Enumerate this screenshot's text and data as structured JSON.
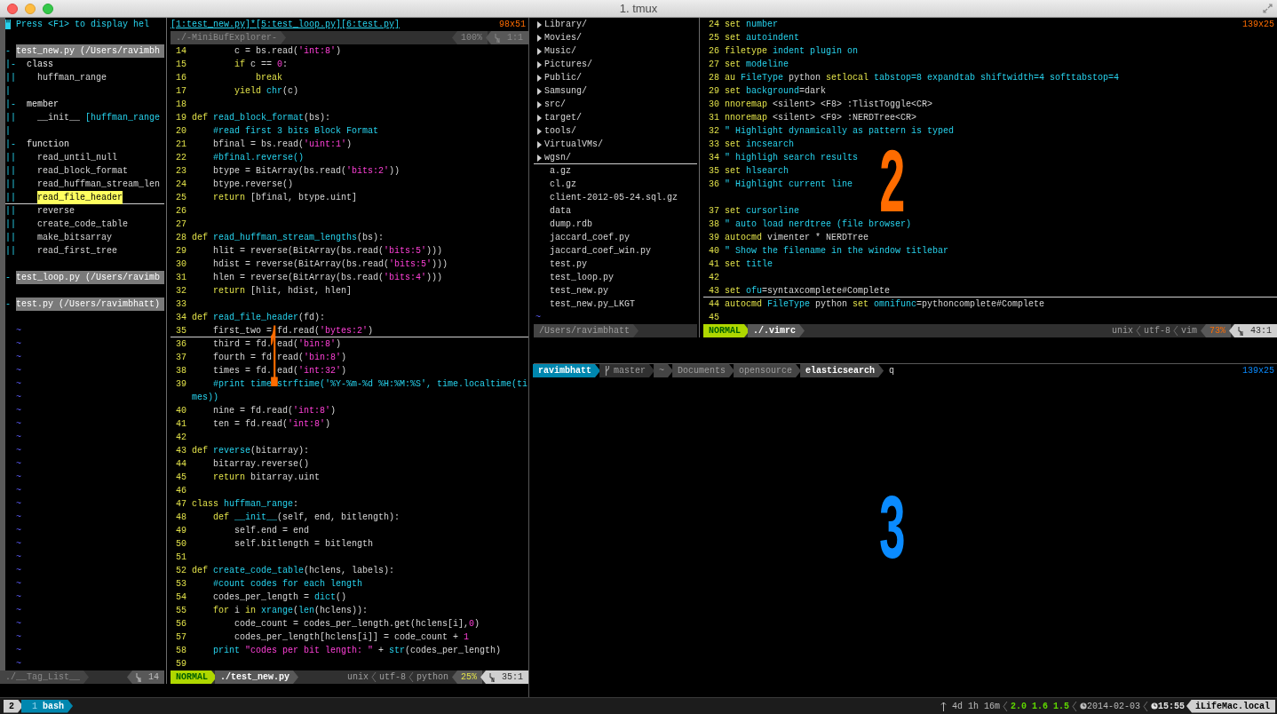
{
  "window": {
    "title": "1. tmux"
  },
  "pane_1": {
    "active": false,
    "size": "98x51",
    "pane_number": "1",
    "taglist": {
      "rows": [
        {
          "kind": "help",
          "fold": "\"",
          "label": "Press <F1> to display hel"
        },
        {
          "kind": "blank"
        },
        {
          "kind": "file",
          "fold": "-",
          "label": "test_new.py (/Users/ravimbh"
        },
        {
          "kind": "group",
          "fold": "|-",
          "label": "class"
        },
        {
          "kind": "tag",
          "fold": "||",
          "label": "huffman_range",
          "selected": false
        },
        {
          "kind": "blank",
          "fold": "|"
        },
        {
          "kind": "group",
          "fold": "|-",
          "label": "member"
        },
        {
          "kind": "tag",
          "fold": "||",
          "label": "__init__",
          "scope": "[huffman_range",
          "selected": false
        },
        {
          "kind": "blank",
          "fold": "|"
        },
        {
          "kind": "group",
          "fold": "|-",
          "label": "function"
        },
        {
          "kind": "tag",
          "fold": "||",
          "label": "read_until_null",
          "selected": false
        },
        {
          "kind": "tag",
          "fold": "||",
          "label": "read_block_format",
          "selected": false
        },
        {
          "kind": "tag",
          "fold": "||",
          "label": "read_huffman_stream_len",
          "selected": false
        },
        {
          "kind": "tag",
          "fold": "||",
          "label": "read_file_header",
          "selected": true
        },
        {
          "kind": "tag",
          "fold": "||",
          "label": "reverse",
          "selected": false
        },
        {
          "kind": "tag",
          "fold": "||",
          "label": "create_code_table",
          "selected": false
        },
        {
          "kind": "tag",
          "fold": "||",
          "label": "make_bitsarray",
          "selected": false
        },
        {
          "kind": "tag",
          "fold": "||",
          "label": "read_first_tree",
          "selected": false
        },
        {
          "kind": "blank"
        },
        {
          "kind": "file",
          "fold": "-",
          "label": "test_loop.py (/Users/ravimb"
        },
        {
          "kind": "blank"
        },
        {
          "kind": "file",
          "fold": "-",
          "label": "test.py (/Users/ravimbhatt)"
        },
        {
          "kind": "blank"
        },
        {
          "kind": "tilde",
          "label": "~"
        },
        {
          "kind": "tilde",
          "label": "~"
        },
        {
          "kind": "tilde",
          "label": "~"
        },
        {
          "kind": "tilde",
          "label": "~"
        },
        {
          "kind": "tilde",
          "label": "~"
        },
        {
          "kind": "tilde",
          "label": "~"
        },
        {
          "kind": "tilde",
          "label": "~"
        },
        {
          "kind": "tilde",
          "label": "~"
        },
        {
          "kind": "tilde",
          "label": "~"
        },
        {
          "kind": "tilde",
          "label": "~"
        },
        {
          "kind": "tilde",
          "label": "~"
        },
        {
          "kind": "tilde",
          "label": "~"
        },
        {
          "kind": "tilde",
          "label": "~"
        },
        {
          "kind": "tilde",
          "label": "~"
        },
        {
          "kind": "tilde",
          "label": "~"
        },
        {
          "kind": "tilde",
          "label": "~"
        },
        {
          "kind": "tilde",
          "label": "~"
        },
        {
          "kind": "tilde",
          "label": "~"
        },
        {
          "kind": "tilde",
          "label": "~"
        },
        {
          "kind": "tilde",
          "label": "~"
        },
        {
          "kind": "tilde",
          "label": "~"
        },
        {
          "kind": "tilde",
          "label": "~"
        },
        {
          "kind": "tilde",
          "label": "~"
        },
        {
          "kind": "tilde",
          "label": "~"
        },
        {
          "kind": "tilde",
          "label": "~"
        },
        {
          "kind": "tilde",
          "label": "~"
        }
      ],
      "status": {
        "name": "./__Tag_List__",
        "line": "14"
      }
    },
    "code": {
      "buffers": "[1:test_new.py]*[5:test_loop.py][6:test.py]",
      "explorer_status": {
        "name": "./-MiniBufExplorer-",
        "percent": "100%",
        "position": "1:1"
      },
      "lines": [
        {
          "n": "14",
          "t": [
            {
              "text": "        c = bs.read(",
              "kind": "plain"
            },
            {
              "text": "'int:8'",
              "kind": "string"
            },
            {
              "text": ")",
              "kind": "plain"
            }
          ]
        },
        {
          "n": "15",
          "t": [
            {
              "text": "        if",
              "kind": "keyword"
            },
            {
              "text": " c == ",
              "kind": "plain"
            },
            {
              "text": "0",
              "kind": "string"
            },
            {
              "text": ":",
              "kind": "plain"
            }
          ]
        },
        {
          "n": "16",
          "t": [
            {
              "text": "            break",
              "kind": "keyword"
            }
          ]
        },
        {
          "n": "17",
          "t": [
            {
              "text": "        yield ",
              "kind": "keyword"
            },
            {
              "text": "chr",
              "kind": "name"
            },
            {
              "text": "(c)",
              "kind": "plain"
            }
          ]
        },
        {
          "n": "18"
        },
        {
          "n": "19",
          "t": [
            {
              "text": "def ",
              "kind": "keyword"
            },
            {
              "text": "read_block_format",
              "kind": "name"
            },
            {
              "text": "(bs):",
              "kind": "plain"
            }
          ]
        },
        {
          "n": "20",
          "t": [
            {
              "text": "    #read first 3 bits Block Format",
              "kind": "comment"
            }
          ]
        },
        {
          "n": "21",
          "t": [
            {
              "text": "    bfinal = bs.read(",
              "kind": "plain"
            },
            {
              "text": "'uint:1'",
              "kind": "string"
            },
            {
              "text": ")",
              "kind": "plain"
            }
          ]
        },
        {
          "n": "22",
          "t": [
            {
              "text": "    #bfinal.reverse()",
              "kind": "comment"
            }
          ]
        },
        {
          "n": "23",
          "t": [
            {
              "text": "    btype = BitArray(bs.read(",
              "kind": "plain"
            },
            {
              "text": "'bits:2'",
              "kind": "string"
            },
            {
              "text": "))",
              "kind": "plain"
            }
          ]
        },
        {
          "n": "24",
          "t": [
            {
              "text": "    btype.reverse()",
              "kind": "plain"
            }
          ]
        },
        {
          "n": "25",
          "t": [
            {
              "text": "    return",
              "kind": "keyword"
            },
            {
              "text": " [bfinal, btype.uint]",
              "kind": "plain"
            }
          ]
        },
        {
          "n": "26"
        },
        {
          "n": "27"
        },
        {
          "n": "28",
          "t": [
            {
              "text": "def ",
              "kind": "keyword"
            },
            {
              "text": "read_huffman_stream_lengths",
              "kind": "name"
            },
            {
              "text": "(bs):",
              "kind": "plain"
            }
          ]
        },
        {
          "n": "29",
          "t": [
            {
              "text": "    hlit = reverse(BitArray(bs.read(",
              "kind": "plain"
            },
            {
              "text": "'bits:5'",
              "kind": "string"
            },
            {
              "text": ")))",
              "kind": "plain"
            }
          ]
        },
        {
          "n": "30",
          "t": [
            {
              "text": "    hdist = reverse(BitArray(bs.read(",
              "kind": "plain"
            },
            {
              "text": "'bits:5'",
              "kind": "string"
            },
            {
              "text": ")))",
              "kind": "plain"
            }
          ]
        },
        {
          "n": "31",
          "t": [
            {
              "text": "    hlen = reverse(BitArray(bs.read(",
              "kind": "plain"
            },
            {
              "text": "'bits:4'",
              "kind": "string"
            },
            {
              "text": ")))",
              "kind": "plain"
            }
          ]
        },
        {
          "n": "32",
          "t": [
            {
              "text": "    return",
              "kind": "keyword"
            },
            {
              "text": " [hlit, hdist, hlen]",
              "kind": "plain"
            }
          ]
        },
        {
          "n": "33"
        },
        {
          "n": "34",
          "t": [
            {
              "text": "def ",
              "kind": "keyword"
            },
            {
              "text": "read_file_header",
              "kind": "name"
            },
            {
              "text": "(fd):",
              "kind": "plain"
            }
          ]
        },
        {
          "n": "35",
          "cursorline": true,
          "t": [
            {
              "text": "    first_two = fd.read(",
              "kind": "plain"
            },
            {
              "text": "'bytes:2'",
              "kind": "string"
            },
            {
              "text": ")",
              "kind": "plain"
            }
          ]
        },
        {
          "n": "36",
          "t": [
            {
              "text": "    third = fd. ead(",
              "kind": "plain"
            },
            {
              "text": "'bin:8'",
              "kind": "string"
            },
            {
              "text": ")",
              "kind": "plain"
            }
          ]
        },
        {
          "n": "37",
          "t": [
            {
              "text": "    fourth = fd read(",
              "kind": "plain"
            },
            {
              "text": "'bin:8'",
              "kind": "string"
            },
            {
              "text": ")",
              "kind": "plain"
            }
          ]
        },
        {
          "n": "38",
          "t": [
            {
              "text": "    times = fd. ead(",
              "kind": "plain"
            },
            {
              "text": "'int:32'",
              "kind": "string"
            },
            {
              "text": ")",
              "kind": "plain"
            }
          ]
        },
        {
          "n": "39",
          "t": [
            {
              "text": "    #print time strftime('%Y-%m-%d %H:%M:%S', time.localtime(ti",
              "kind": "comment"
            }
          ]
        },
        {
          "t": [
            {
              "text": "mes))",
              "kind": "comment"
            }
          ]
        },
        {
          "n": "40",
          "t": [
            {
              "text": "    nine = fd.read(",
              "kind": "plain"
            },
            {
              "text": "'int:8'",
              "kind": "string"
            },
            {
              "text": ")",
              "kind": "plain"
            }
          ]
        },
        {
          "n": "41",
          "t": [
            {
              "text": "    ten = fd.read(",
              "kind": "plain"
            },
            {
              "text": "'int:8'",
              "kind": "string"
            },
            {
              "text": ")",
              "kind": "plain"
            }
          ]
        },
        {
          "n": "42"
        },
        {
          "n": "43",
          "t": [
            {
              "text": "def ",
              "kind": "keyword"
            },
            {
              "text": "reverse",
              "kind": "name"
            },
            {
              "text": "(bitarray):",
              "kind": "plain"
            }
          ]
        },
        {
          "n": "44",
          "t": [
            {
              "text": "    bitarray.reverse()",
              "kind": "plain"
            }
          ]
        },
        {
          "n": "45",
          "t": [
            {
              "text": "    return",
              "kind": "keyword"
            },
            {
              "text": " bitarray.uint",
              "kind": "plain"
            }
          ]
        },
        {
          "n": "46"
        },
        {
          "n": "47",
          "t": [
            {
              "text": "class ",
              "kind": "keyword"
            },
            {
              "text": "huffman_range",
              "kind": "name"
            },
            {
              "text": ":",
              "kind": "plain"
            }
          ]
        },
        {
          "n": "48",
          "t": [
            {
              "text": "    def ",
              "kind": "keyword"
            },
            {
              "text": "__init__",
              "kind": "name"
            },
            {
              "text": "(self, end, bitlength):",
              "kind": "plain"
            }
          ]
        },
        {
          "n": "49",
          "t": [
            {
              "text": "        self.end = end",
              "kind": "plain"
            }
          ]
        },
        {
          "n": "50",
          "t": [
            {
              "text": "        self.bitlength = bitlength",
              "kind": "plain"
            }
          ]
        },
        {
          "n": "51"
        },
        {
          "n": "52",
          "t": [
            {
              "text": "def ",
              "kind": "keyword"
            },
            {
              "text": "create_code_table",
              "kind": "name"
            },
            {
              "text": "(hclens, labels):",
              "kind": "plain"
            }
          ]
        },
        {
          "n": "53",
          "t": [
            {
              "text": "    #count codes for each length",
              "kind": "comment"
            }
          ]
        },
        {
          "n": "54",
          "t": [
            {
              "text": "    codes_per_length = ",
              "kind": "plain"
            },
            {
              "text": "dict",
              "kind": "name"
            },
            {
              "text": "()",
              "kind": "plain"
            }
          ]
        },
        {
          "n": "55",
          "t": [
            {
              "text": "    for",
              "kind": "keyword"
            },
            {
              "text": " i ",
              "kind": "plain"
            },
            {
              "text": "in ",
              "kind": "keyword"
            },
            {
              "text": "xrange",
              "kind": "name"
            },
            {
              "text": "(",
              "kind": "plain"
            },
            {
              "text": "len",
              "kind": "name"
            },
            {
              "text": "(hclens)):",
              "kind": "plain"
            }
          ]
        },
        {
          "n": "56",
          "t": [
            {
              "text": "        code_count = codes_per_length.get(hclens[i],",
              "kind": "plain"
            },
            {
              "text": "0",
              "kind": "string"
            },
            {
              "text": ")",
              "kind": "plain"
            }
          ]
        },
        {
          "n": "57",
          "t": [
            {
              "text": "        codes_per_length[hclens[i]] = code_count + ",
              "kind": "plain"
            },
            {
              "text": "1",
              "kind": "string"
            }
          ]
        },
        {
          "n": "58",
          "t": [
            {
              "text": "    print ",
              "kind": "name"
            },
            {
              "text": "\"codes per bit length: \"",
              "kind": "string"
            },
            {
              "text": " + ",
              "kind": "plain"
            },
            {
              "text": "str",
              "kind": "name"
            },
            {
              "text": "(codes_per_length)",
              "kind": "plain"
            }
          ]
        },
        {
          "n": "59"
        }
      ],
      "status": {
        "mode": "NORMAL",
        "file": "./test_new.py",
        "format": "unix",
        "encoding": "utf-8",
        "filetype": "python",
        "percent": "25%",
        "position": "35:1"
      }
    }
  },
  "pane_2": {
    "active": false,
    "size": "139x25",
    "pane_number": "2",
    "nerdtree": {
      "entries": [
        {
          "kind": "dir",
          "name": "Library/"
        },
        {
          "kind": "dir",
          "name": "Movies/"
        },
        {
          "kind": "dir",
          "name": "Music/"
        },
        {
          "kind": "dir",
          "name": "Pictures/"
        },
        {
          "kind": "dir",
          "name": "Public/"
        },
        {
          "kind": "dir",
          "name": "Samsung/"
        },
        {
          "kind": "dir",
          "name": "src/"
        },
        {
          "kind": "dir",
          "name": "target/"
        },
        {
          "kind": "dir",
          "name": "tools/"
        },
        {
          "kind": "dir",
          "name": "VirtualVMs/"
        },
        {
          "kind": "dir",
          "name": "wgsn/",
          "cursorline": true
        },
        {
          "kind": "file",
          "name": "a.gz"
        },
        {
          "kind": "file",
          "name": "cl.gz"
        },
        {
          "kind": "file",
          "name": "client-2012-05-24.sql.gz"
        },
        {
          "kind": "file",
          "name": "data"
        },
        {
          "kind": "file",
          "name": "dump.rdb"
        },
        {
          "kind": "file",
          "name": "jaccard_coef.py"
        },
        {
          "kind": "file",
          "name": "jaccard_coef_win.py"
        },
        {
          "kind": "file",
          "name": "test.py"
        },
        {
          "kind": "file",
          "name": "test_loop.py"
        },
        {
          "kind": "file",
          "name": "test_new.py"
        },
        {
          "kind": "file",
          "name": "test_new.py_LKGT"
        }
      ],
      "tilde": "~",
      "status": "/Users/ravimbhatt"
    },
    "vimrc": {
      "lines": [
        {
          "n": "24",
          "t": [
            {
              "text": "set",
              "kind": "keyword"
            },
            {
              "text": " number",
              "kind": "name"
            }
          ]
        },
        {
          "n": "25",
          "t": [
            {
              "text": "set",
              "kind": "keyword"
            },
            {
              "text": " autoindent",
              "kind": "name"
            }
          ]
        },
        {
          "n": "26",
          "t": [
            {
              "text": "filetype",
              "kind": "keyword"
            },
            {
              "text": " indent plugin on",
              "kind": "name"
            }
          ]
        },
        {
          "n": "27",
          "t": [
            {
              "text": "set",
              "kind": "keyword"
            },
            {
              "text": " modeline",
              "kind": "name"
            }
          ]
        },
        {
          "n": "28",
          "t": [
            {
              "text": "au",
              "kind": "keyword"
            },
            {
              "text": " FileType",
              "kind": "name"
            },
            {
              "text": " python",
              "kind": "plain"
            },
            {
              "text": " setlocal",
              "kind": "keyword"
            },
            {
              "text": " tabstop=8 expandtab shiftwidth=4 softtabstop=4",
              "kind": "name"
            }
          ]
        },
        {
          "n": "29",
          "t": [
            {
              "text": "set",
              "kind": "keyword"
            },
            {
              "text": " background",
              "kind": "name"
            },
            {
              "text": "=dark",
              "kind": "plain"
            }
          ]
        },
        {
          "n": "30",
          "t": [
            {
              "text": "nnoremap",
              "kind": "keyword"
            },
            {
              "text": " <silent> <F8> :TlistToggle<CR>",
              "kind": "plain"
            }
          ]
        },
        {
          "n": "31",
          "t": [
            {
              "text": "nnoremap",
              "kind": "keyword"
            },
            {
              "text": " <silent> <F9> :NERDTree<CR>",
              "kind": "plain"
            }
          ]
        },
        {
          "n": "32",
          "t": [
            {
              "text": "\" Highlight dynamically as pattern is typed",
              "kind": "comment"
            }
          ]
        },
        {
          "n": "33",
          "t": [
            {
              "text": "set",
              "kind": "keyword"
            },
            {
              "text": " incsearch",
              "kind": "name"
            }
          ]
        },
        {
          "n": "34",
          "t": [
            {
              "text": "\" highligh search results",
              "kind": "comment"
            }
          ]
        },
        {
          "n": "35",
          "t": [
            {
              "text": "set",
              "kind": "keyword"
            },
            {
              "text": " hlsearch",
              "kind": "name"
            }
          ]
        },
        {
          "n": "36",
          "wraps": true,
          "t": [
            {
              "text": "\" Highlight current line",
              "kind": "comment"
            }
          ]
        },
        {
          "n": "37",
          "t": [
            {
              "text": "set",
              "kind": "keyword"
            },
            {
              "text": " cursorline",
              "kind": "name"
            }
          ]
        },
        {
          "n": "38",
          "t": [
            {
              "text": "\" auto load nerdtree (file browser)",
              "kind": "comment"
            }
          ]
        },
        {
          "n": "39",
          "t": [
            {
              "text": "autocmd",
              "kind": "keyword"
            },
            {
              "text": " vimenter * NERDTree",
              "kind": "plain"
            }
          ]
        },
        {
          "n": "40",
          "t": [
            {
              "text": "\" Show the filename in the window titlebar",
              "kind": "comment"
            }
          ]
        },
        {
          "n": "41",
          "t": [
            {
              "text": "set",
              "kind": "keyword"
            },
            {
              "text": " title",
              "kind": "name"
            }
          ]
        },
        {
          "n": "42"
        },
        {
          "n": "43",
          "cursorline": true,
          "t": [
            {
              "text": "set",
              "kind": "keyword"
            },
            {
              "text": " ofu",
              "kind": "name"
            },
            {
              "text": "=syntaxcomplete#Complete",
              "kind": "plain"
            }
          ]
        },
        {
          "n": "44",
          "t": [
            {
              "text": "autocmd",
              "kind": "keyword"
            },
            {
              "text": " FileType",
              "kind": "name"
            },
            {
              "text": " python",
              "kind": "plain"
            },
            {
              "text": " set",
              "kind": "keyword"
            },
            {
              "text": " omnifunc",
              "kind": "name"
            },
            {
              "text": "=pythoncomplete#Complete",
              "kind": "plain"
            }
          ]
        },
        {
          "n": "45"
        }
      ],
      "status": {
        "mode": "NORMAL",
        "file": "./.vimrc",
        "format": "unix",
        "encoding": "utf-8",
        "filetype": "vim",
        "percent": "73%",
        "position": "43:1"
      }
    }
  },
  "pane_3": {
    "active": true,
    "size": "139x25",
    "pane_number": "3",
    "prompt": {
      "segments": [
        {
          "kind": "user",
          "text": "ravimbhatt"
        },
        {
          "kind": "branch",
          "text": "master"
        },
        {
          "kind": "path",
          "text": "~"
        },
        {
          "kind": "path",
          "text": "Documents"
        },
        {
          "kind": "path",
          "text": "opensource"
        },
        {
          "kind": "cwd",
          "text": "elasticsearch"
        }
      ],
      "input": "q"
    }
  },
  "status_bar": {
    "session": "2",
    "windows": [
      {
        "index": "1",
        "name": "bash",
        "selected": true
      }
    ],
    "uptime": "4d 1h 16m",
    "load": "2.0 1.6 1.5",
    "date": "2014-02-03",
    "time": "15:55",
    "host": "iLifeMac.local"
  }
}
